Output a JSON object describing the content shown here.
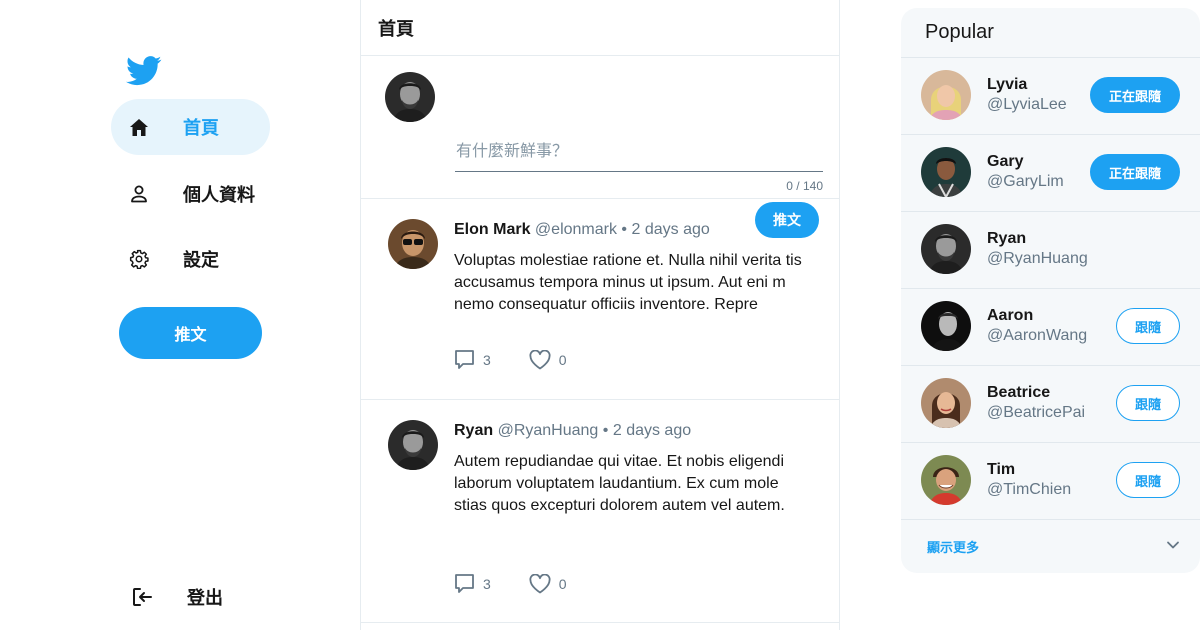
{
  "nav": {
    "items": [
      {
        "label": "首頁",
        "icon": "home-icon",
        "active": true
      },
      {
        "label": "個人資料",
        "icon": "user-icon",
        "active": false
      },
      {
        "label": "設定",
        "icon": "gear-icon",
        "active": false
      }
    ],
    "tweet_button": "推文",
    "logout_label": "登出"
  },
  "main": {
    "title": "首頁",
    "composer": {
      "placeholder": "有什麼新鮮事？",
      "counter": "0 / 140",
      "button": "推文"
    },
    "tweets": [
      {
        "name": "Elon Mark",
        "handle": "@elonmark",
        "separator": "•",
        "time": "2 days ago",
        "text": "Voluptas molestiae ratione et. Nulla nihil verita tis accusamus tempora minus ut ipsum. Aut eni m nemo consequatur officiis inventore. Repre",
        "replies": "3",
        "likes": "0"
      },
      {
        "name": "Ryan",
        "handle": "@RyanHuang",
        "separator": "•",
        "time": "2 days ago",
        "text": "Autem repudiandae qui vitae. Et nobis eligendi laborum voluptatem laudantium. Ex cum mole stias quos excepturi dolorem autem vel autem.",
        "replies": "3",
        "likes": "0"
      }
    ]
  },
  "popular": {
    "title": "Popular",
    "users": [
      {
        "name": "Lyvia",
        "handle": "@LyviaLee",
        "button": "正在跟隨",
        "following": true
      },
      {
        "name": "Gary",
        "handle": "@GaryLim",
        "button": "正在跟隨",
        "following": true
      },
      {
        "name": "Ryan",
        "handle": "@RyanHuang",
        "button": "",
        "following": null
      },
      {
        "name": "Aaron",
        "handle": "@AaronWang",
        "button": "跟隨",
        "following": false
      },
      {
        "name": "Beatrice",
        "handle": "@BeatricePai",
        "button": "跟隨",
        "following": false
      },
      {
        "name": "Tim",
        "handle": "@TimChien",
        "button": "跟隨",
        "following": false
      }
    ],
    "show_more": "顯示更多"
  },
  "colors": {
    "accent": "#1da1f2",
    "active_bg": "#e6f4fc",
    "muted": "#657786",
    "panel_bg": "#f5f8fa"
  }
}
